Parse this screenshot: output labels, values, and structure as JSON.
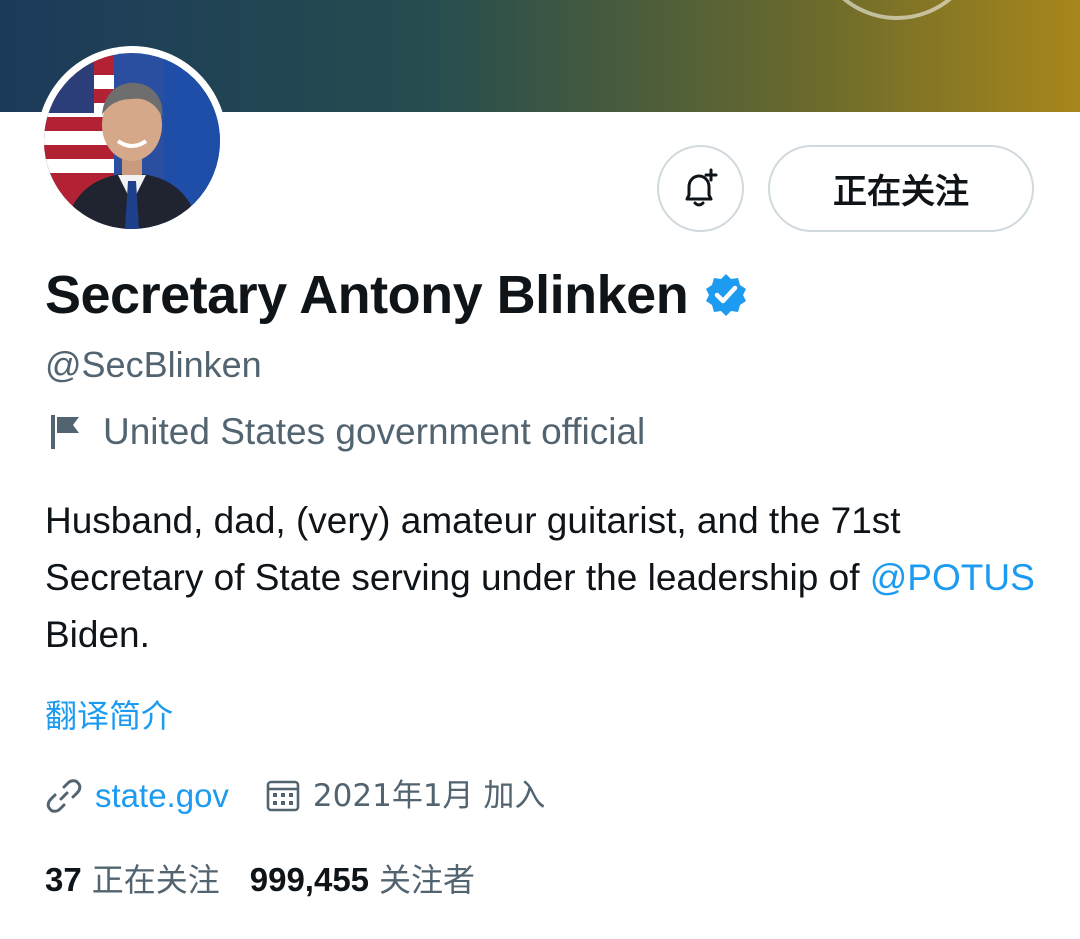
{
  "profile": {
    "name": "Secretary Antony Blinken",
    "handle": "@SecBlinken",
    "label": "United States government official",
    "bio_text_1": "Husband, dad, (very) amateur guitarist, and the 71st Secretary of State serving under the leadership of ",
    "bio_mention": "@POTUS",
    "bio_text_2": " Biden.",
    "translate_label": "翻译简介",
    "website": "state.gov",
    "joined": "2021年1月 加入",
    "following_count": "37",
    "following_label": "正在关注",
    "followers_count": "999,455",
    "followers_label": "关注者"
  },
  "actions": {
    "follow_button": "正在关注",
    "notify_icon": "bell-plus-icon"
  },
  "icons": {
    "verified": "verified-badge-icon",
    "label_flag": "flag-icon",
    "website": "link-icon",
    "joined": "calendar-icon"
  },
  "colors": {
    "accent": "#1d9bf0",
    "secondary_text": "#536471",
    "primary_text": "#0f1419",
    "border": "#cfd9de"
  }
}
